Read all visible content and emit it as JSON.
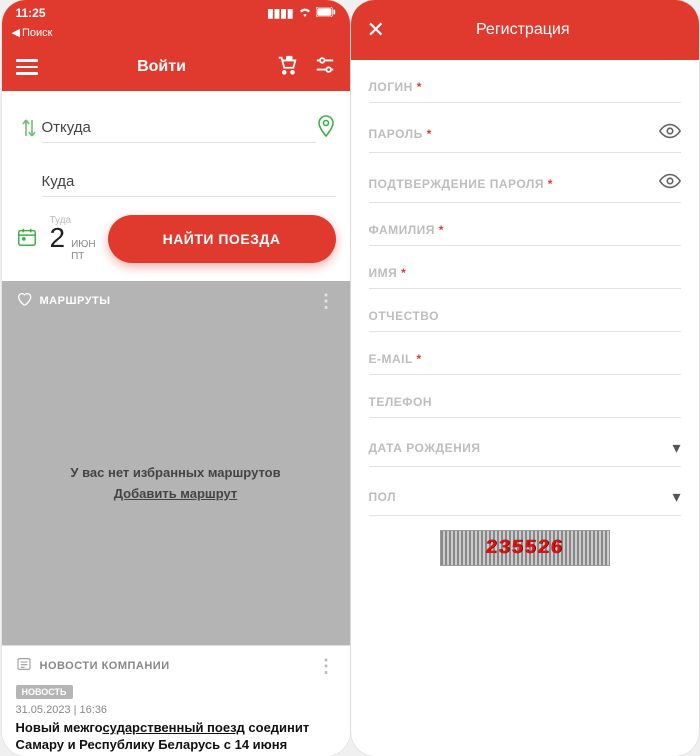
{
  "left": {
    "status": {
      "time": "11:25",
      "back_search": "Поиск"
    },
    "header": {
      "title": "Войти"
    },
    "search": {
      "from_placeholder": "Откуда",
      "to_placeholder": "Куда",
      "date_label": "Туда",
      "date_day": "2",
      "date_month": "ИЮН",
      "date_dow": "Пт",
      "find_button": "НАЙТИ ПОЕЗДА"
    },
    "routes": {
      "heading": "МАРШРУТЫ",
      "empty_msg": "У вас нет избранных маршрутов",
      "add_link": "Добавить маршрут"
    },
    "news": {
      "heading": "НОВОСТИ КОМПАНИИ",
      "tag": "НОВОСТЬ",
      "date": "31.05.2023 | 16:36",
      "title_pre": "Новый межго",
      "title_ul": "сударственный поезд",
      "title_post": " соединит Самару и Республику Беларусь с 14 июня"
    }
  },
  "right": {
    "title": "Регистрация",
    "fields": {
      "login": "ЛОГИН",
      "password": "ПАРОЛЬ",
      "password_confirm": "ПОДТВЕРЖДЕНИЕ ПАРОЛЯ",
      "lastname": "ФАМИЛИЯ",
      "firstname": "ИМЯ",
      "patronymic": "ОТЧЕСТВО",
      "email": "E-MAIL",
      "phone": "ТЕЛЕФОН",
      "birthdate": "ДАТА РОЖДЕНИЯ",
      "gender": "ПОЛ"
    },
    "captcha": "235526"
  }
}
